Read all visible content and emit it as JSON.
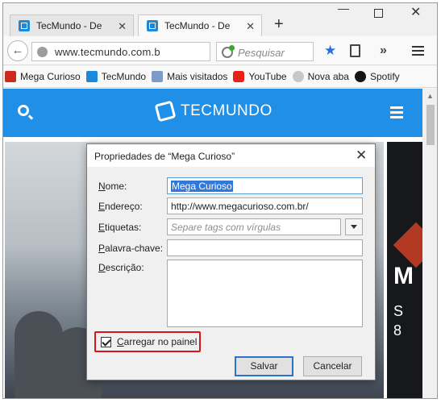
{
  "tabs": [
    {
      "title": "TecMundo - De",
      "close": "✕"
    },
    {
      "title": "TecMundo - De",
      "close": "✕"
    }
  ],
  "new_tab": "+",
  "window_controls": {
    "minimize": "—",
    "close": "✕"
  },
  "navbar": {
    "back": "←",
    "url": "www.tecmundo.com.b",
    "reload": "↻",
    "search_placeholder": "Pesquisar",
    "bookmark_star": "★",
    "overflow": "»"
  },
  "bookmarks": [
    {
      "label": "Mega Curioso",
      "icon": "mega-curioso-icon"
    },
    {
      "label": "TecMundo",
      "icon": "tecmundo-icon"
    },
    {
      "label": "Mais visitados",
      "icon": "most-visited-icon"
    },
    {
      "label": "YouTube",
      "icon": "youtube-icon"
    },
    {
      "label": "Nova aba",
      "icon": "new-tab-icon"
    },
    {
      "label": "Spotify",
      "icon": "spotify-icon"
    }
  ],
  "site": {
    "logo_text": "TECMUNDO",
    "brand_color": "#1f8fe8"
  },
  "hero_right": {
    "big": "M",
    "small_1": "S",
    "small_2": "8"
  },
  "dialog": {
    "title": "Propriedades de “Mega Curioso”",
    "close": "✕",
    "name_label_u": "N",
    "name_label_rest": "ome:",
    "name_value": "Mega Curioso",
    "address_label_u": "E",
    "address_label_rest": "ndereço:",
    "address_value": "http://www.megacurioso.com.br/",
    "tags_label_u": "E",
    "tags_label_rest": "tiquetas:",
    "tags_placeholder": "Separe tags com vírgulas",
    "keyword_label_u": "P",
    "keyword_label_rest": "alavra-chave:",
    "keyword_value": "",
    "description_label_u": "D",
    "description_label_rest": "escrição:",
    "description_value": "",
    "checkbox_label_u": "C",
    "checkbox_label_rest": "arregar no painel",
    "checkbox_checked": true,
    "save_button": "Salvar",
    "cancel_button": "Cancelar"
  }
}
